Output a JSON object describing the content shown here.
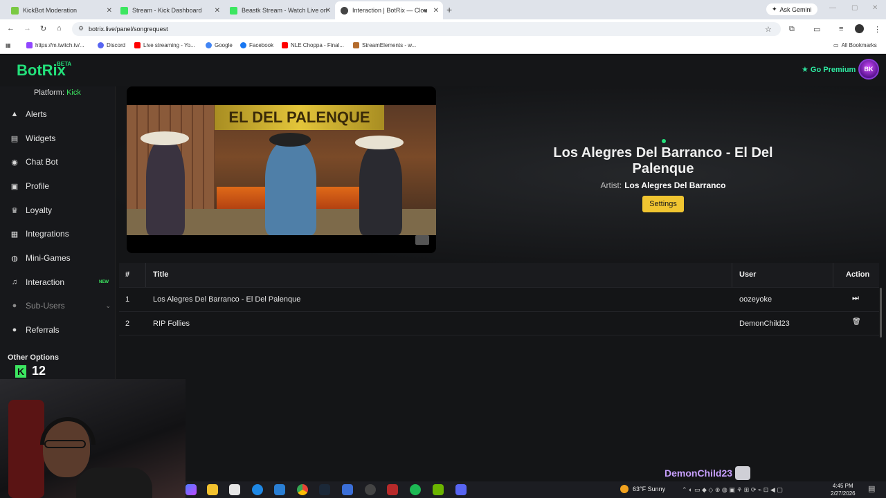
{
  "browser": {
    "tabs": [
      {
        "label": "KickBot Moderation",
        "color": "#7ac943"
      },
      {
        "label": "Stream - Kick Dashboard",
        "color": "#3ce660"
      },
      {
        "label": "Beastk Stream - Watch Live on",
        "color": "#3ce660"
      },
      {
        "label": "Interaction | BotRix — Clou",
        "color": "#444444",
        "active": true
      }
    ],
    "ask_gemini": "Ask Gemini",
    "url": "botrix.live/panel/songrequest",
    "bookmarks": [
      {
        "label": "https://m.twitch.tv/...",
        "color": "#9146ff"
      },
      {
        "label": "Discord",
        "color": "#5865f2"
      },
      {
        "label": "Live streaming - Yo...",
        "color": "#ff0000"
      },
      {
        "label": "Google",
        "color": "#4285f4"
      },
      {
        "label": "Facebook",
        "color": "#1877f2"
      },
      {
        "label": "NLE Choppa - Final...",
        "color": "#ff0000"
      },
      {
        "label": "StreamElements - w...",
        "color": "#b36b2c"
      }
    ],
    "all_bookmarks": "All Bookmarks"
  },
  "app": {
    "logo": "BotRix",
    "beta": "BETA",
    "premium": "Go Premium",
    "avatar": "BK",
    "platform_label": "Platform:",
    "platform_value": "Kick",
    "nav": [
      {
        "label": "Alerts",
        "icon": "warning-icon",
        "glyph": "▲"
      },
      {
        "label": "Widgets",
        "icon": "widgets-icon",
        "glyph": "▤"
      },
      {
        "label": "Chat Bot",
        "icon": "robot-icon",
        "glyph": "◉"
      },
      {
        "label": "Profile",
        "icon": "profile-icon",
        "glyph": "▣"
      },
      {
        "label": "Loyalty",
        "icon": "trophy-icon",
        "glyph": "♛"
      },
      {
        "label": "Integrations",
        "icon": "integrations-icon",
        "glyph": "▦"
      },
      {
        "label": "Mini-Games",
        "icon": "gamepad-icon",
        "glyph": "◍"
      },
      {
        "label": "Interaction",
        "icon": "music-icon",
        "glyph": "♫",
        "badge": "NEW"
      },
      {
        "label": "Sub-Users",
        "icon": "users-icon",
        "glyph": "●",
        "dim": true
      },
      {
        "label": "Referrals",
        "icon": "referrals-icon",
        "glyph": "●"
      }
    ],
    "other_options": "Other Options"
  },
  "now_playing": {
    "video_sign": "EL DEL PALENQUE",
    "title": "Los Alegres Del Barranco - El Del Palenque",
    "artist_label": "Artist:",
    "artist": "Los Alegres Del Barranco",
    "settings_label": "Settings"
  },
  "queue": {
    "headers": {
      "num": "#",
      "title": "Title",
      "user": "User",
      "action": "Action"
    },
    "rows": [
      {
        "num": "1",
        "title": "Los Alegres Del Barranco - El Del Palenque",
        "user": "oozeyoke",
        "action": "skip-icon",
        "glyph": "⏭"
      },
      {
        "num": "2",
        "title": "RIP Follies",
        "user": "DemonChild23",
        "action": "trash-icon",
        "glyph": "🗑"
      }
    ]
  },
  "overlay": {
    "kick_count": "12",
    "chat_username": "DemonChild23"
  },
  "taskbar": {
    "weather": "63°F  Sunny",
    "time": "4:45 PM",
    "date": "2/27/2026"
  }
}
